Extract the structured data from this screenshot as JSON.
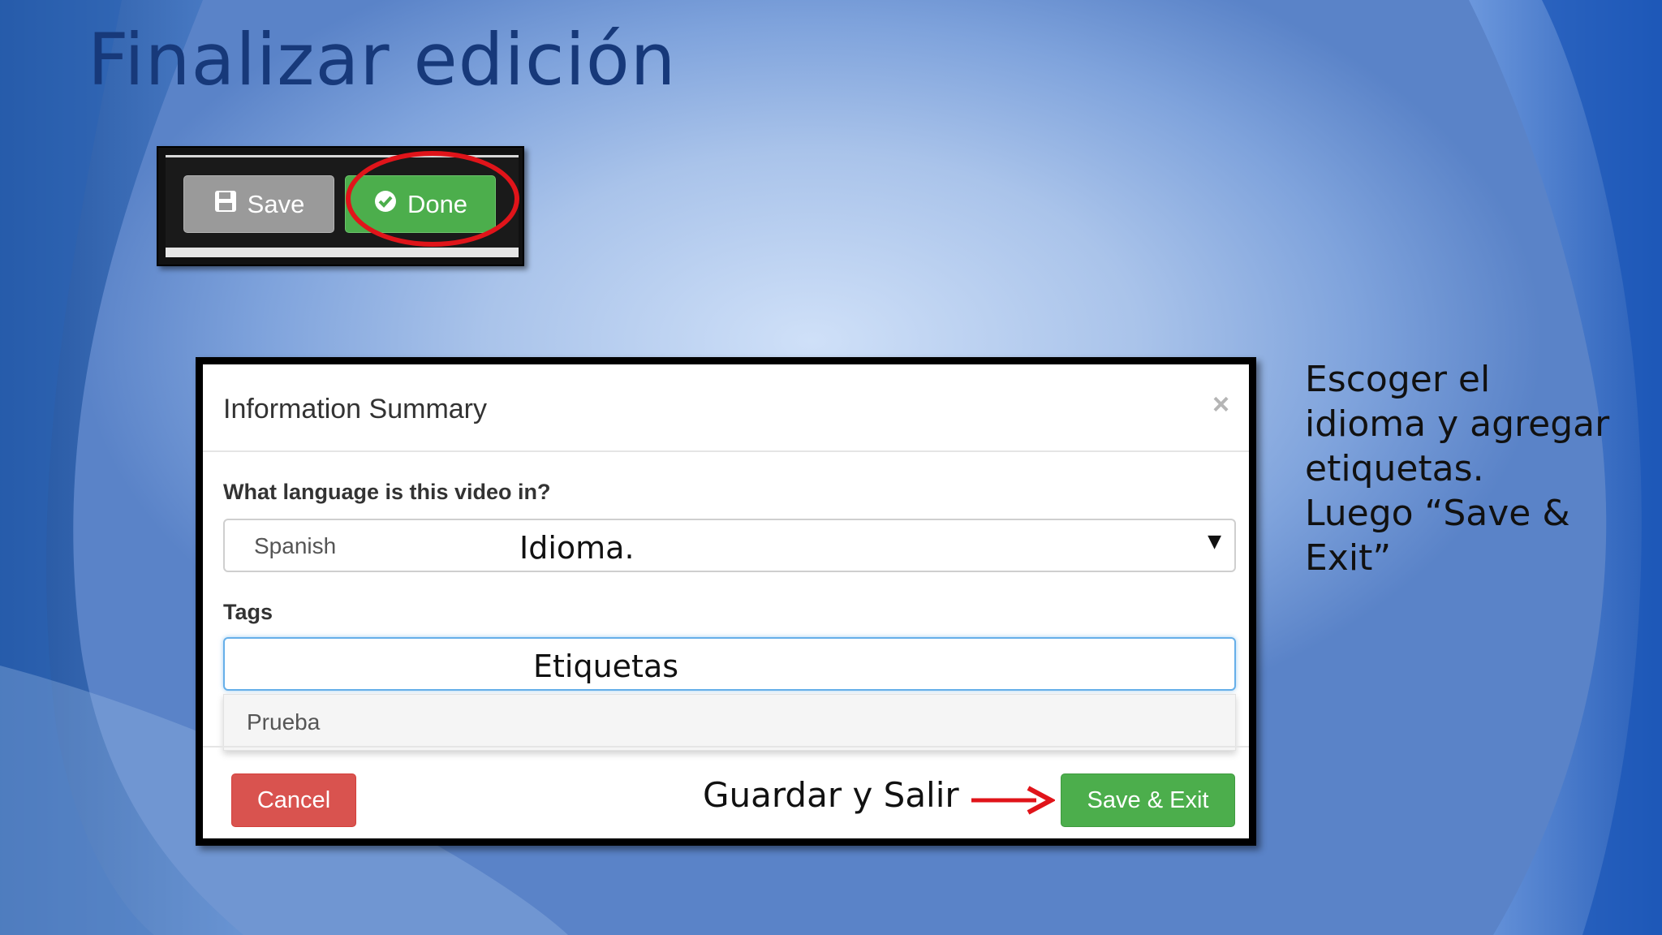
{
  "slide": {
    "title": "Finalizar edición"
  },
  "toolbar": {
    "save_label": "Save",
    "done_label": "Done",
    "save_icon": "floppy-disk-icon",
    "done_icon": "check-circle-icon"
  },
  "modal": {
    "title": "Information Summary",
    "close_symbol": "×",
    "language_label": "What language is this video in?",
    "language_selected": "Spanish",
    "tags_label": "Tags",
    "tags_value": "",
    "suggestion": "Prueba",
    "cancel_label": "Cancel",
    "save_exit_label": "Save & Exit"
  },
  "annotations": {
    "language_overlay": "Idioma.",
    "tags_overlay": "Etiquetas",
    "save_exit_overlay": "Guardar y Salir",
    "side_note_lines": [
      "Escoger el",
      "idioma y agregar",
      "etiquetas.",
      "Luego “Save &",
      "Exit”"
    ]
  },
  "colors": {
    "title": "#17397a",
    "done_green": "#4cae4c",
    "cancel_red": "#d9534f",
    "highlight_red": "#e0141a"
  }
}
